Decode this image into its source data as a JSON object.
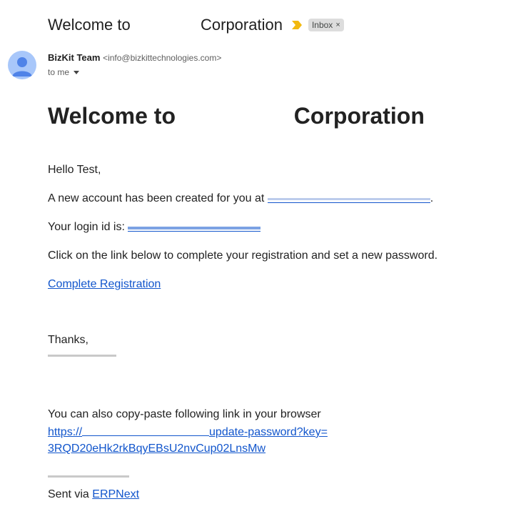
{
  "header": {
    "subject_prefix": "Welcome to",
    "subject_suffix": "Corporation",
    "label_chip": "Inbox",
    "label_remove": "×"
  },
  "sender": {
    "name": "BizKit Team",
    "email": "<info@bizkittechnologies.com>",
    "to_label": "to me",
    "avatar_icon": "person-avatar-icon"
  },
  "message": {
    "heading_prefix": "Welcome to",
    "heading_suffix": "Corporation",
    "greeting": "Hello Test,",
    "account_line": "A new account has been created for you at",
    "account_url_period": ".",
    "login_line": "Your login id is:",
    "instruction": "Click on the link below to complete your registration and set a new password.",
    "complete_link": "Complete Registration",
    "thanks": "Thanks,",
    "copy_paste_line": "You can also copy-paste following link in your browser",
    "reset_link_line1_start": "https://",
    "reset_link_line1_end": "update-password?key=",
    "reset_link_line2": "3RQD20eHk2rkBqyEBsU2nvCup02LnsMw",
    "sent_via": "Sent via",
    "erpnext_link": "ERPNext"
  },
  "colors": {
    "link": "#1155cc",
    "importance_marker": "#f2b90f",
    "chip_bg": "#dddddd",
    "avatar_bg": "#a8c7fa",
    "avatar_fg": "#4f83e8"
  }
}
